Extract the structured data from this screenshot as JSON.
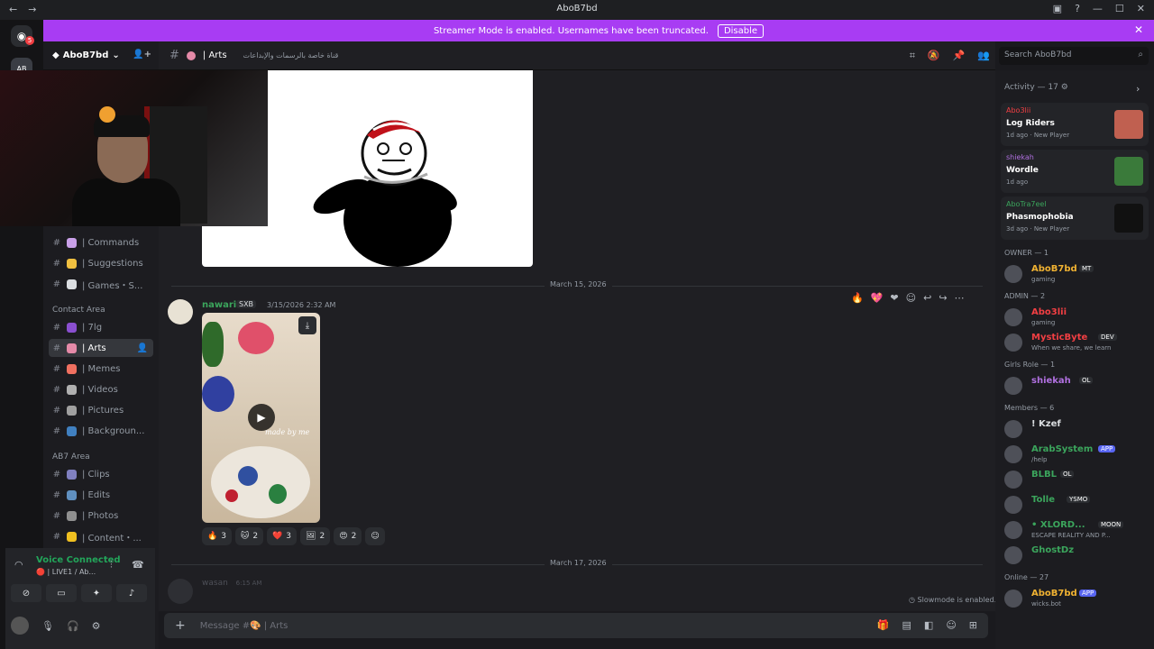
{
  "app": {
    "window_title": "AboB7bd"
  },
  "banner": {
    "text": "Streamer Mode is enabled. Usernames have been truncated.",
    "disable_label": "Disable",
    "color": "#a83cf3"
  },
  "rail": {
    "badge": "5",
    "server_initials": "AB"
  },
  "server": {
    "name": "AboB7bd"
  },
  "sidebar": {
    "channels_top": [
      {
        "label": "| Commands",
        "color": "#c9a0e8"
      },
      {
        "label": "| Suggestions",
        "color": "#f0c040"
      },
      {
        "label": "| Games・S...",
        "color": "#dbdee1"
      }
    ],
    "category_contact": "Contact Area",
    "channels_contact": [
      {
        "label": "| 7lg",
        "color": "#8a4fd0"
      },
      {
        "label": "| Arts",
        "color": "#e58aa8",
        "selected": true
      },
      {
        "label": "| Memes",
        "color": "#f07060"
      },
      {
        "label": "| Videos",
        "color": "#b0b0b0"
      },
      {
        "label": "| Pictures",
        "color": "#a0a0a0"
      },
      {
        "label": "| Backgroun...",
        "color": "#4080c0"
      }
    ],
    "category_ab7": "AB7 Area",
    "channels_ab7": [
      {
        "label": "| Clips",
        "color": "#8080c0"
      },
      {
        "label": "| Edits",
        "color": "#6090c0"
      },
      {
        "label": "| Photos",
        "color": "#909090"
      },
      {
        "label": "| Content・...",
        "color": "#f0c020"
      }
    ]
  },
  "voice": {
    "status": "Voice Connected",
    "sub": "🔴 | LIVE1 / Ab..."
  },
  "channel_header": {
    "name": "| Arts",
    "topic": "قناة خاصة بالرسمات والإبداعات"
  },
  "search": {
    "placeholder": "Search AboB7bd"
  },
  "messages": {
    "date1": "March 15, 2026",
    "author": "nawarii",
    "tag": "SXB",
    "time": "3/15/2026 2:32 AM",
    "video_caption": "made by me",
    "reactions": [
      {
        "emoji": "🔥",
        "count": "3"
      },
      {
        "emoji": "🐱",
        "count": "2"
      },
      {
        "emoji": "❤️",
        "count": "3"
      },
      {
        "emoji": "🖼",
        "count": "2"
      },
      {
        "emoji": "😍",
        "count": "2"
      }
    ],
    "date2": "March 17, 2026",
    "next_author": "wasan",
    "next_time": "6:15 AM",
    "slowmode": "Slowmode is enabled."
  },
  "composer": {
    "placeholder": "Message #🎨 | Arts"
  },
  "right": {
    "activity_title": "Activity — 17",
    "activities": [
      {
        "user": "Abo3lii",
        "user_color": "#f23f43",
        "game": "Log Riders",
        "meta": "1d ago · New Player",
        "thumb": "#c06050"
      },
      {
        "user": "shiekah",
        "user_color": "#b070e0",
        "game": "Wordle",
        "meta": "1d ago",
        "thumb": "#3a7a3a"
      },
      {
        "user": "AboTra7eel",
        "user_color": "#3ba55c",
        "game": "Phasmophobia",
        "meta": "3d ago · New Player",
        "thumb": "#111111"
      }
    ],
    "owner_title": "OWNER — 1",
    "owner": {
      "name": "AboB7bd",
      "badge": "MT",
      "status": "gaming",
      "color": "#f0b232"
    },
    "admin_title": "ADMIN — 2",
    "admins": [
      {
        "name": "Abo3lii",
        "status": "gaming",
        "color": "#f23f43"
      },
      {
        "name": "MysticByte",
        "badge": "DEV",
        "status": "When we share, we learn",
        "color": "#f23f43"
      }
    ],
    "girls_title": "Girls Role — 1",
    "girls": [
      {
        "name": "shiekah",
        "badge": "OL",
        "color": "#b070e0"
      }
    ],
    "members_title": "Members — 6",
    "members": [
      {
        "name": "! Kzef",
        "status": "",
        "color": "#dbdee1"
      },
      {
        "name": "ArabSystem",
        "badge": "APP",
        "status": "/help",
        "color": "#3ba55c"
      },
      {
        "name": "BLBL",
        "badge": "OL",
        "status": "",
        "color": "#3ba55c"
      },
      {
        "name": "Tolle",
        "badge": "YSMO",
        "status": "",
        "color": "#3ba55c"
      },
      {
        "name": "• XLORD...",
        "badge": "MOON",
        "status": "ESCAPE REALITY AND P...",
        "color": "#3ba55c"
      },
      {
        "name": "GhostDz",
        "status": "",
        "color": "#3ba55c"
      }
    ],
    "online_title": "Online — 27",
    "online": [
      {
        "name": "AboB7bd",
        "badge": "APP",
        "status": "wicks.bot",
        "color": "#f0b232"
      }
    ]
  }
}
